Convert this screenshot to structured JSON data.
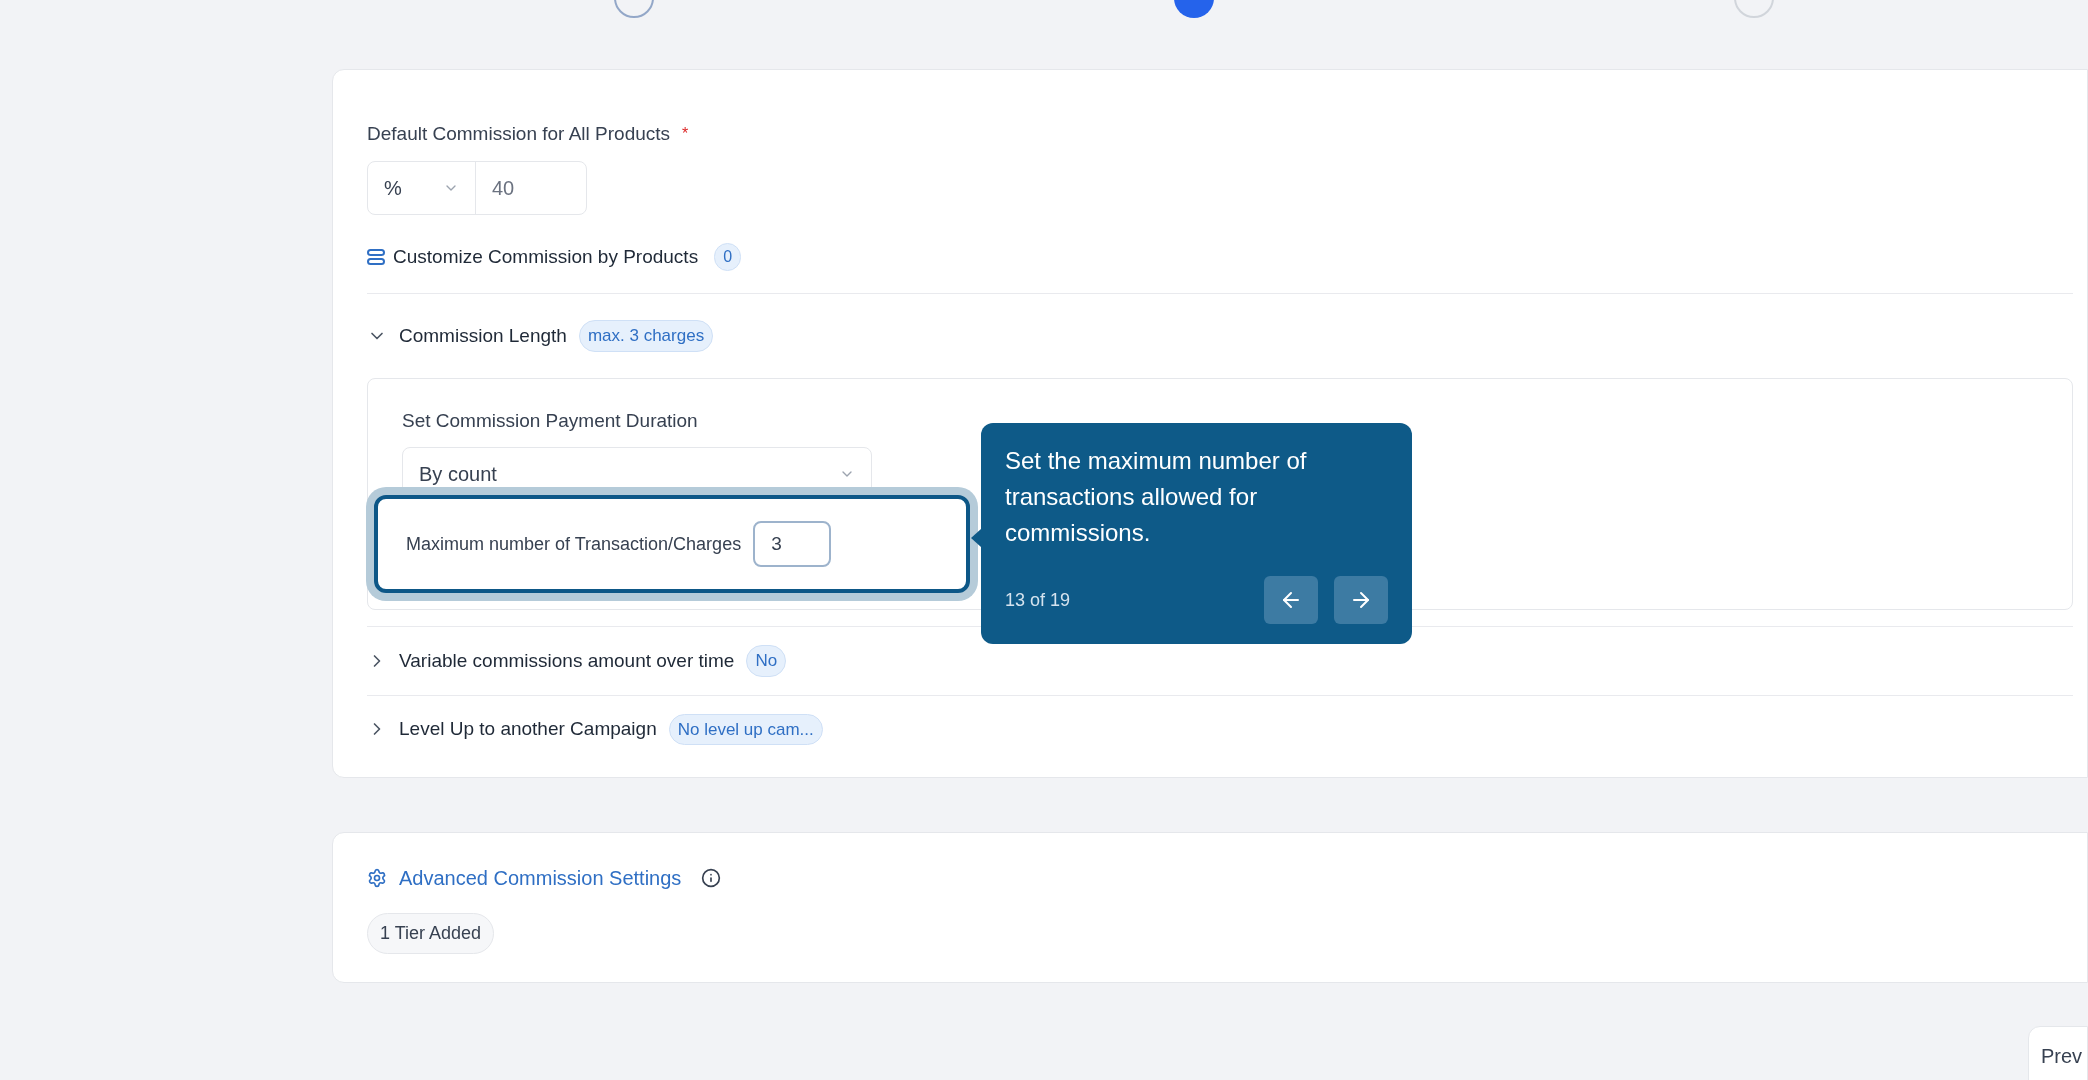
{
  "default_commission": {
    "label": "Default Commission for All Products",
    "required_mark": "*",
    "unit": "%",
    "value": "40"
  },
  "customize": {
    "label": "Customize Commission by Products",
    "count": "0"
  },
  "sections": [
    {
      "title": "Commission Length",
      "badge": "max. 3 charges",
      "expanded": true
    },
    {
      "title": "Variable commissions amount over time",
      "badge": "No",
      "expanded": false
    },
    {
      "title": "Level Up to another Campaign",
      "badge": "No level up cam...",
      "expanded": false
    }
  ],
  "commission_length": {
    "duration_label": "Set Commission Payment Duration",
    "duration_value": "By count",
    "max_label": "Maximum number of Transaction/Charges",
    "max_value": "3"
  },
  "tour": {
    "text": "Set the maximum number of transactions allowed for commissions.",
    "step": "13 of 19"
  },
  "advanced": {
    "title": "Advanced Commission Settings",
    "tag": "1 Tier Added"
  },
  "footer": {
    "button": "Prev"
  }
}
